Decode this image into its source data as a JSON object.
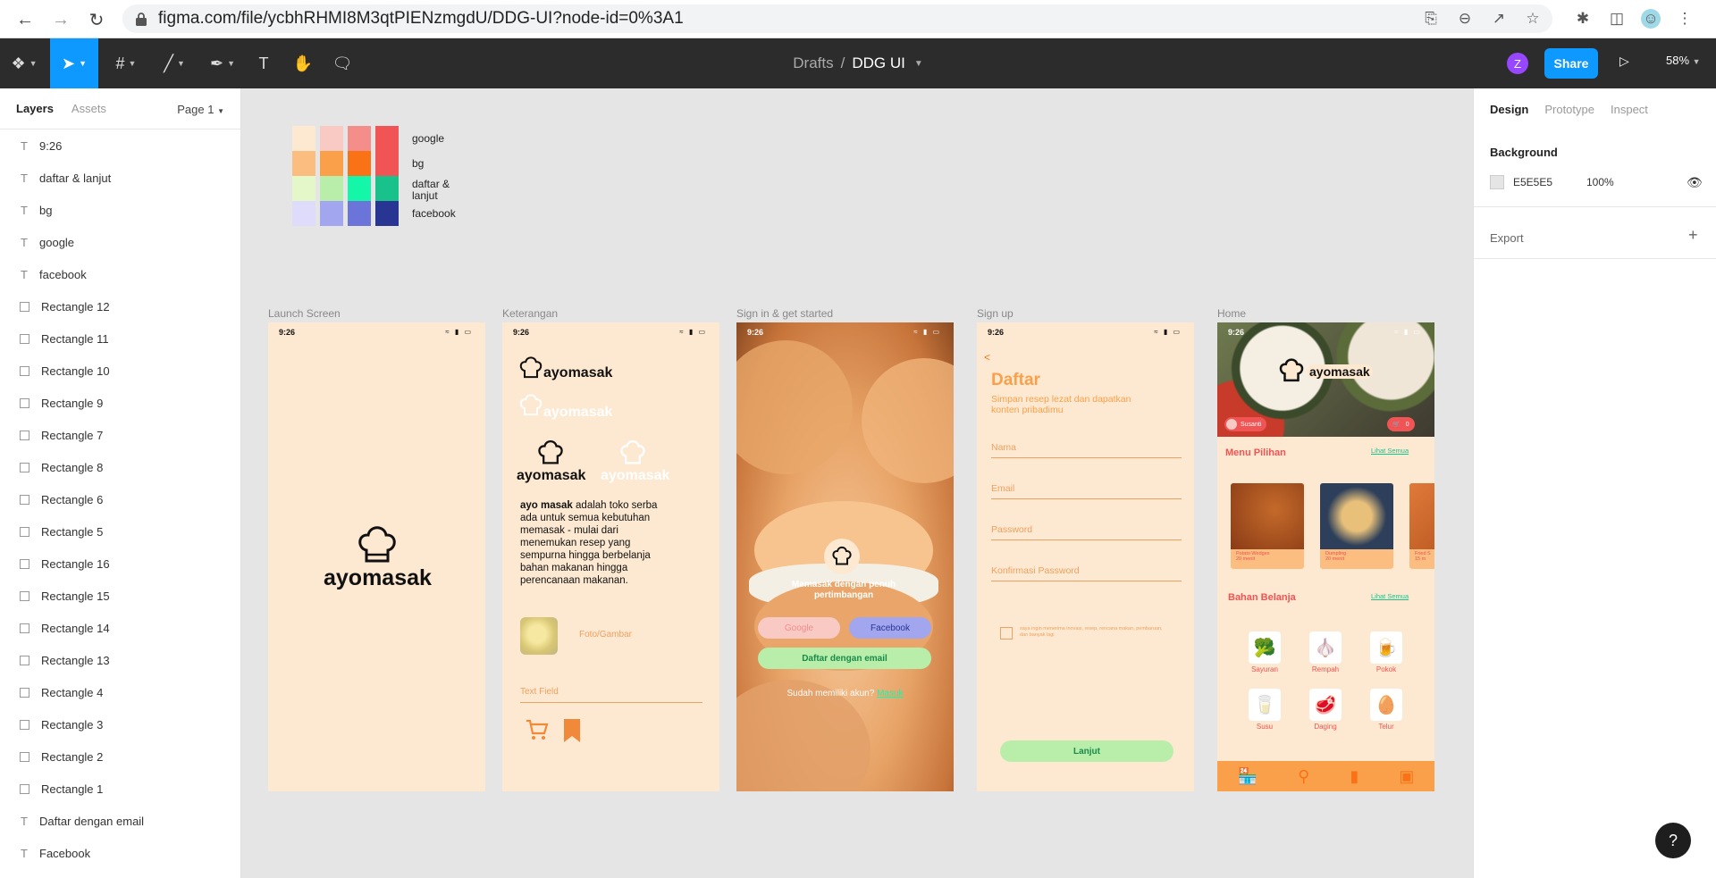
{
  "browser": {
    "url": "figma.com/file/ycbhRHMI8M3qtPIENzmgdU/DDG-UI?node-id=0%3A1"
  },
  "toolbar": {
    "breadcrumb_parent": "Drafts",
    "breadcrumb_sep": "/",
    "file_name": "DDG UI",
    "avatar_initial": "Z",
    "share_label": "Share",
    "zoom": "58%"
  },
  "left_panel": {
    "tab_layers": "Layers",
    "tab_assets": "Assets",
    "page": "Page 1",
    "layers": [
      {
        "type": "text",
        "name": "9:26"
      },
      {
        "type": "text",
        "name": "daftar & lanjut"
      },
      {
        "type": "text",
        "name": "bg"
      },
      {
        "type": "text",
        "name": "google"
      },
      {
        "type": "text",
        "name": "facebook"
      },
      {
        "type": "rect",
        "name": "Rectangle 12"
      },
      {
        "type": "rect",
        "name": "Rectangle 11"
      },
      {
        "type": "rect",
        "name": "Rectangle 10"
      },
      {
        "type": "rect",
        "name": "Rectangle 9"
      },
      {
        "type": "rect",
        "name": "Rectangle 7"
      },
      {
        "type": "rect",
        "name": "Rectangle 8"
      },
      {
        "type": "rect",
        "name": "Rectangle 6"
      },
      {
        "type": "rect",
        "name": "Rectangle 5"
      },
      {
        "type": "rect",
        "name": "Rectangle 16"
      },
      {
        "type": "rect",
        "name": "Rectangle 15"
      },
      {
        "type": "rect",
        "name": "Rectangle 14"
      },
      {
        "type": "rect",
        "name": "Rectangle 13"
      },
      {
        "type": "rect",
        "name": "Rectangle 4"
      },
      {
        "type": "rect",
        "name": "Rectangle 3"
      },
      {
        "type": "rect",
        "name": "Rectangle 2"
      },
      {
        "type": "rect",
        "name": "Rectangle 1"
      },
      {
        "type": "text",
        "name": "Daftar dengan email"
      },
      {
        "type": "text",
        "name": "Facebook"
      }
    ]
  },
  "right_panel": {
    "tab_design": "Design",
    "tab_prototype": "Prototype",
    "tab_inspect": "Inspect",
    "background_title": "Background",
    "bg_hex": "E5E5E5",
    "bg_opacity": "100%",
    "export_title": "Export"
  },
  "palette": {
    "rows": [
      {
        "label": "google",
        "colors": [
          "#fde9d1",
          "#f9c9c4",
          "#f38e8a",
          "#f05454"
        ]
      },
      {
        "label": "bg",
        "colors": [
          "#fbbd80",
          "#fba04a",
          "#f97316",
          "#f05454"
        ]
      },
      {
        "label": "daftar & lanjut",
        "colors": [
          "#e3f7c8",
          "#b8edaa",
          "#14f7a9",
          "#19c28b"
        ]
      },
      {
        "label": "facebook",
        "colors": [
          "#dedcfa",
          "#a1a6ee",
          "#6b74d8",
          "#283593"
        ]
      }
    ]
  },
  "frames": {
    "launch": {
      "label": "Launch Screen",
      "time": "9:26",
      "logo": "ayomasak"
    },
    "keterangan": {
      "label": "Keterangan",
      "time": "9:26",
      "logo1": "ayomasak",
      "logo2": "ayomasak",
      "logo3": "ayomasak",
      "logo4": "ayomasak",
      "desc_bold": "ayo masak",
      "desc": " adalah toko serba ada untuk semua kebutuhan memasak - mulai dari menemukan resep yang sempurna hingga berbelanja bahan makanan hingga perencanaan makanan.",
      "foto_label": "Foto/Gambar",
      "text_field": "Text Field"
    },
    "signin": {
      "label": "Sign in & get started",
      "time": "9:26",
      "tagline": "Memasak dengan penuh pertimbangan",
      "google": "Google",
      "facebook": "Facebook",
      "email": "Daftar dengan email",
      "have_account": "Sudah memiliki akun?",
      "login": "Masuk"
    },
    "signup": {
      "label": "Sign up",
      "time": "9:26",
      "back": "<",
      "title": "Daftar",
      "subtitle": "Simpan resep lezat dan dapatkan konten pribadimu",
      "field_name": "Nama",
      "field_email": "Email",
      "field_password": "Password",
      "field_confirm": "Konfirmasi Password",
      "agree": "saya ingin menerima inovasi, resep, rencana makan, pembaruan, dan banyak lagi",
      "next": "Lanjut"
    },
    "home": {
      "label": "Home",
      "time": "9:26",
      "logo": "ayomasak",
      "user": "Susanti",
      "cart_count": "0",
      "menu_title": "Menu Pilihan",
      "see_all": "Lihat Semua",
      "menus": [
        {
          "name": "Potato Wedges",
          "time": "20 menit"
        },
        {
          "name": "Dumpling",
          "time": "20 menit"
        },
        {
          "name": "Fried S",
          "time": "15 m"
        }
      ],
      "bahan_title": "Bahan Belanja",
      "see_all2": "Lihat Semua",
      "bahan": [
        "Sayuran",
        "Rempah",
        "Pokok",
        "Susu",
        "Daging",
        "Telur"
      ]
    }
  }
}
